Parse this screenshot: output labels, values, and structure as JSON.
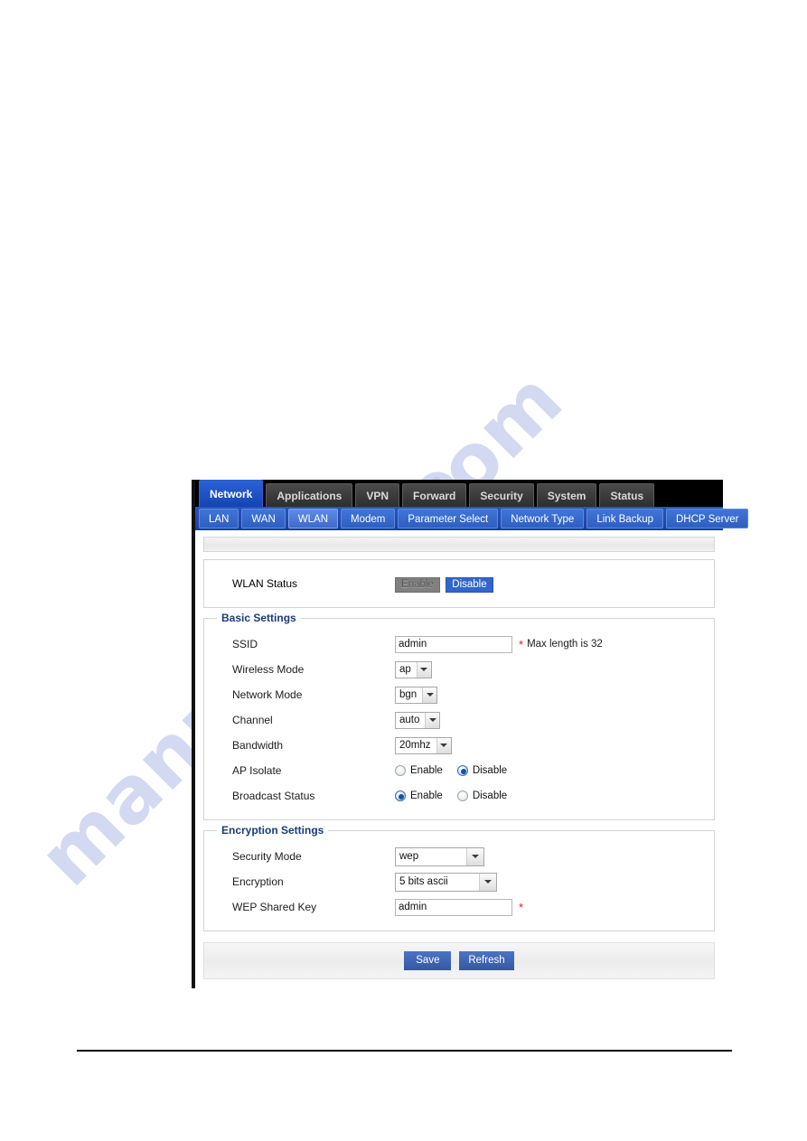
{
  "watermark": {
    "line1": "manualshive",
    "line2": ".com"
  },
  "nav_primary": {
    "tabs": [
      {
        "label": "Network",
        "active": true
      },
      {
        "label": "Applications",
        "active": false
      },
      {
        "label": "VPN",
        "active": false
      },
      {
        "label": "Forward",
        "active": false
      },
      {
        "label": "Security",
        "active": false
      },
      {
        "label": "System",
        "active": false
      },
      {
        "label": "Status",
        "active": false
      }
    ]
  },
  "nav_secondary": {
    "tabs": [
      {
        "label": "LAN",
        "active": false
      },
      {
        "label": "WAN",
        "active": false
      },
      {
        "label": "WLAN",
        "active": true
      },
      {
        "label": "Modem",
        "active": false
      },
      {
        "label": "Parameter Select",
        "active": false
      },
      {
        "label": "Network Type",
        "active": false
      },
      {
        "label": "Link Backup",
        "active": false
      },
      {
        "label": "DHCP Server",
        "active": false
      }
    ]
  },
  "wlan_status": {
    "label": "WLAN Status",
    "enable_label": "Enable",
    "disable_label": "Disable",
    "selected": "Disable"
  },
  "basic_settings": {
    "title": "Basic Settings",
    "ssid": {
      "label": "SSID",
      "value": "admin",
      "required_mark": "*",
      "hint": "Max length is 32"
    },
    "wireless_mode": {
      "label": "Wireless Mode",
      "value": "ap"
    },
    "network_mode": {
      "label": "Network Mode",
      "value": "bgn"
    },
    "channel": {
      "label": "Channel",
      "value": "auto"
    },
    "bandwidth": {
      "label": "Bandwidth",
      "value": "20mhz"
    },
    "ap_isolate": {
      "label": "AP Isolate",
      "enable_label": "Enable",
      "disable_label": "Disable",
      "selected": "Disable"
    },
    "broadcast_status": {
      "label": "Broadcast Status",
      "enable_label": "Enable",
      "disable_label": "Disable",
      "selected": "Enable"
    }
  },
  "encryption_settings": {
    "title": "Encryption Settings",
    "security_mode": {
      "label": "Security Mode",
      "value": "wep"
    },
    "encryption": {
      "label": "Encryption",
      "value": "5 bits ascii"
    },
    "wep_shared_key": {
      "label": "WEP Shared Key",
      "value": "admin",
      "required_mark": "*"
    }
  },
  "footer": {
    "save_label": "Save",
    "refresh_label": "Refresh"
  },
  "colors": {
    "primary_tab_active": "#1b4fc4",
    "secondary_nav": "#1d46a8",
    "group_title": "#1b3c7a",
    "action_button": "#3f63b8",
    "required_star": "#d2232a",
    "toggle_on": "#3366cc",
    "toggle_off": "#808080"
  }
}
